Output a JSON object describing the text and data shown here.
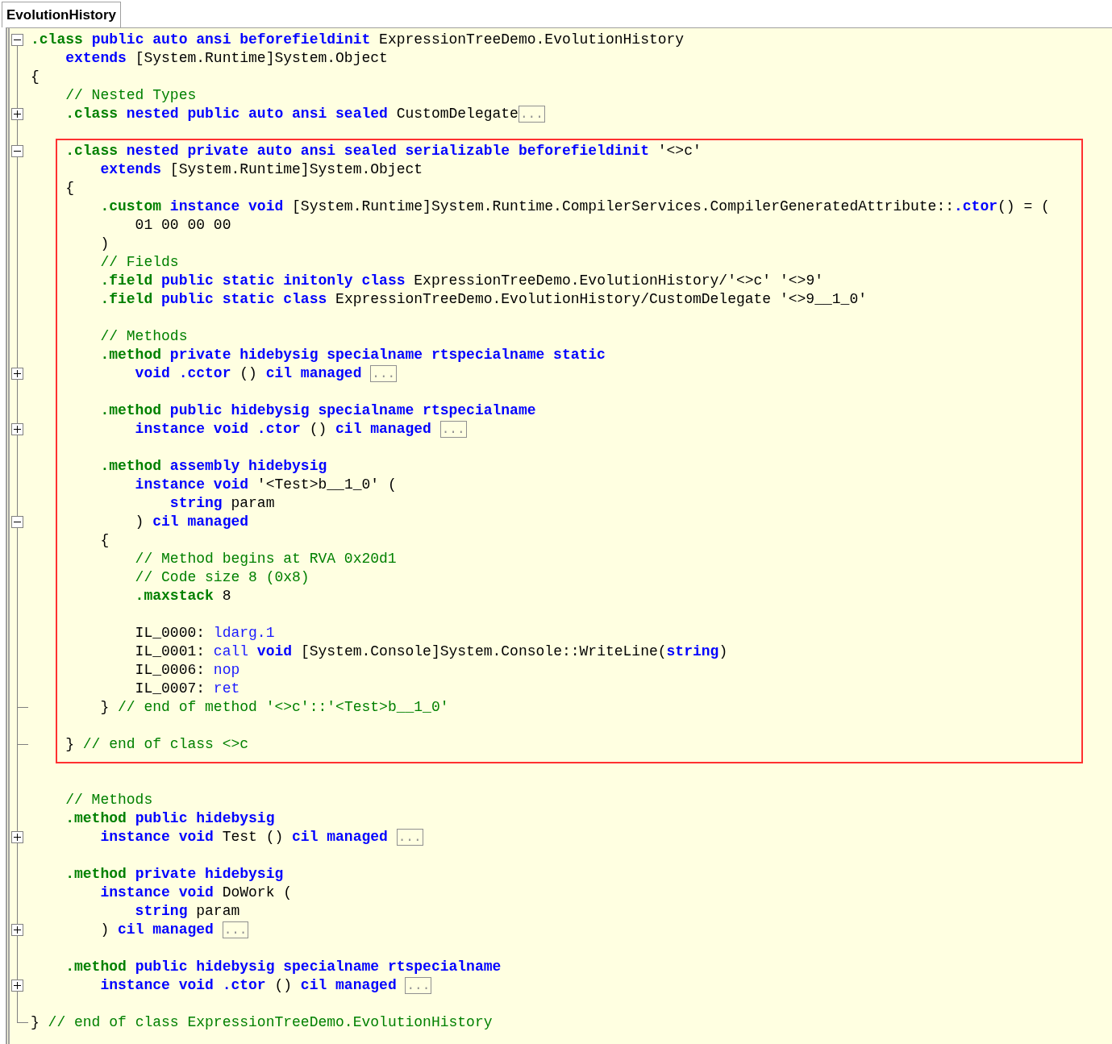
{
  "tab": {
    "label": "EvolutionHistory"
  },
  "blocks": [
    {
      "highlighted": false,
      "lines": [
        {
          "kind": "fold",
          "expanded": true,
          "tokens": [
            {
              "kind": "directive",
              "text": ".class "
            },
            {
              "kind": "keyword",
              "text": "public auto ansi beforefieldinit "
            },
            {
              "kind": "text",
              "text": "ExpressionTreeDemo.EvolutionHistory"
            }
          ]
        },
        {
          "kind": "code",
          "tokens": [
            {
              "kind": "keyword",
              "text": "    extends "
            },
            {
              "kind": "text",
              "text": "[System.Runtime]System.Object"
            }
          ]
        },
        {
          "kind": "code",
          "tokens": [
            {
              "kind": "text",
              "text": "{"
            }
          ]
        },
        {
          "kind": "code",
          "tokens": [
            {
              "kind": "comment",
              "text": "    // Nested Types"
            }
          ]
        },
        {
          "kind": "fold",
          "expanded": false,
          "tokens": [
            {
              "kind": "directive",
              "text": "    .class "
            },
            {
              "kind": "keyword",
              "text": "nested public auto ansi sealed "
            },
            {
              "kind": "text",
              "text": "CustomDelegate"
            }
          ],
          "collapsed": "..."
        },
        {
          "kind": "blank"
        }
      ]
    },
    {
      "highlighted": true,
      "lines": [
        {
          "kind": "fold",
          "expanded": true,
          "tokens": [
            {
              "kind": "directive",
              "text": "    .class "
            },
            {
              "kind": "keyword",
              "text": "nested private auto ansi sealed serializable beforefieldinit "
            },
            {
              "kind": "text",
              "text": "'<>c'"
            }
          ]
        },
        {
          "kind": "code",
          "tokens": [
            {
              "kind": "keyword",
              "text": "        extends "
            },
            {
              "kind": "text",
              "text": "[System.Runtime]System.Object"
            }
          ]
        },
        {
          "kind": "code",
          "tokens": [
            {
              "kind": "text",
              "text": "    {"
            }
          ]
        },
        {
          "kind": "code",
          "tokens": [
            {
              "kind": "directive",
              "text": "        .custom "
            },
            {
              "kind": "keyword",
              "text": "instance void "
            },
            {
              "kind": "text",
              "text": "[System.Runtime]System.Runtime.CompilerServices.CompilerGeneratedAttribute::"
            },
            {
              "kind": "keyword",
              "text": ".ctor"
            },
            {
              "kind": "text",
              "text": "() = ("
            }
          ]
        },
        {
          "kind": "code",
          "tokens": [
            {
              "kind": "text",
              "text": "            01 00 00 00"
            }
          ]
        },
        {
          "kind": "code",
          "tokens": [
            {
              "kind": "text",
              "text": "        )"
            }
          ]
        },
        {
          "kind": "code",
          "tokens": [
            {
              "kind": "comment",
              "text": "        // Fields"
            }
          ]
        },
        {
          "kind": "code",
          "tokens": [
            {
              "kind": "directive",
              "text": "        .field "
            },
            {
              "kind": "keyword",
              "text": "public static initonly class "
            },
            {
              "kind": "text",
              "text": "ExpressionTreeDemo.EvolutionHistory/'<>c' '<>9'"
            }
          ]
        },
        {
          "kind": "code",
          "tokens": [
            {
              "kind": "directive",
              "text": "        .field "
            },
            {
              "kind": "keyword",
              "text": "public static class "
            },
            {
              "kind": "text",
              "text": "ExpressionTreeDemo.EvolutionHistory/CustomDelegate '<>9__1_0'"
            }
          ]
        },
        {
          "kind": "blank"
        },
        {
          "kind": "code",
          "tokens": [
            {
              "kind": "comment",
              "text": "        // Methods"
            }
          ]
        },
        {
          "kind": "code",
          "tokens": [
            {
              "kind": "directive",
              "text": "        .method "
            },
            {
              "kind": "keyword",
              "text": "private hidebysig specialname rtspecialname static"
            }
          ]
        },
        {
          "kind": "fold",
          "expanded": false,
          "tokens": [
            {
              "kind": "keyword",
              "text": "            void .cctor "
            },
            {
              "kind": "text",
              "text": "() "
            },
            {
              "kind": "keyword",
              "text": "cil managed "
            }
          ],
          "collapsed": "..."
        },
        {
          "kind": "blank"
        },
        {
          "kind": "code",
          "tokens": [
            {
              "kind": "directive",
              "text": "        .method "
            },
            {
              "kind": "keyword",
              "text": "public hidebysig specialname rtspecialname"
            }
          ]
        },
        {
          "kind": "fold",
          "expanded": false,
          "tokens": [
            {
              "kind": "keyword",
              "text": "            instance void .ctor "
            },
            {
              "kind": "text",
              "text": "() "
            },
            {
              "kind": "keyword",
              "text": "cil managed "
            }
          ],
          "collapsed": "..."
        },
        {
          "kind": "blank"
        },
        {
          "kind": "code",
          "tokens": [
            {
              "kind": "directive",
              "text": "        .method "
            },
            {
              "kind": "keyword",
              "text": "assembly hidebysig"
            }
          ]
        },
        {
          "kind": "code",
          "tokens": [
            {
              "kind": "keyword",
              "text": "            instance void "
            },
            {
              "kind": "text",
              "text": "'<Test>b__1_0' ("
            }
          ]
        },
        {
          "kind": "code",
          "tokens": [
            {
              "kind": "keyword",
              "text": "                string "
            },
            {
              "kind": "text",
              "text": "param"
            }
          ]
        },
        {
          "kind": "fold",
          "expanded": true,
          "tokens": [
            {
              "kind": "text",
              "text": "            ) "
            },
            {
              "kind": "keyword",
              "text": "cil managed"
            }
          ]
        },
        {
          "kind": "code",
          "tokens": [
            {
              "kind": "text",
              "text": "        {"
            }
          ]
        },
        {
          "kind": "code",
          "tokens": [
            {
              "kind": "comment",
              "text": "            // Method begins at RVA 0x20d1"
            }
          ]
        },
        {
          "kind": "code",
          "tokens": [
            {
              "kind": "comment",
              "text": "            // Code size 8 (0x8)"
            }
          ]
        },
        {
          "kind": "code",
          "tokens": [
            {
              "kind": "directive",
              "text": "            .maxstack "
            },
            {
              "kind": "text",
              "text": "8"
            }
          ]
        },
        {
          "kind": "blank"
        },
        {
          "kind": "code",
          "tokens": [
            {
              "kind": "text",
              "text": "            IL_0000: "
            },
            {
              "kind": "opcode",
              "text": "ldarg.1"
            }
          ]
        },
        {
          "kind": "code",
          "tokens": [
            {
              "kind": "text",
              "text": "            IL_0001: "
            },
            {
              "kind": "opcode",
              "text": "call "
            },
            {
              "kind": "keyword",
              "text": "void "
            },
            {
              "kind": "text",
              "text": "[System.Console]System.Console::WriteLine("
            },
            {
              "kind": "keyword",
              "text": "string"
            },
            {
              "kind": "text",
              "text": ")"
            }
          ]
        },
        {
          "kind": "code",
          "tokens": [
            {
              "kind": "text",
              "text": "            IL_0006: "
            },
            {
              "kind": "opcode",
              "text": "nop"
            }
          ]
        },
        {
          "kind": "code",
          "tokens": [
            {
              "kind": "text",
              "text": "            IL_0007: "
            },
            {
              "kind": "opcode",
              "text": "ret"
            }
          ]
        },
        {
          "kind": "fold-end",
          "tokens": [
            {
              "kind": "text",
              "text": "        } "
            },
            {
              "kind": "comment",
              "text": "// end of method '<>c'::'<Test>b__1_0'"
            }
          ]
        },
        {
          "kind": "blank"
        },
        {
          "kind": "fold-end",
          "tokens": [
            {
              "kind": "text",
              "text": "    } "
            },
            {
              "kind": "comment",
              "text": "// end of class <>c"
            }
          ]
        }
      ]
    },
    {
      "highlighted": false,
      "lines": [
        {
          "kind": "blank"
        },
        {
          "kind": "blank"
        },
        {
          "kind": "code",
          "tokens": [
            {
              "kind": "comment",
              "text": "    // Methods"
            }
          ]
        },
        {
          "kind": "code",
          "tokens": [
            {
              "kind": "directive",
              "text": "    .method "
            },
            {
              "kind": "keyword",
              "text": "public hidebysig"
            }
          ]
        },
        {
          "kind": "fold",
          "expanded": false,
          "tokens": [
            {
              "kind": "keyword",
              "text": "        instance void "
            },
            {
              "kind": "text",
              "text": "Test () "
            },
            {
              "kind": "keyword",
              "text": "cil managed "
            }
          ],
          "collapsed": "..."
        },
        {
          "kind": "blank"
        },
        {
          "kind": "code",
          "tokens": [
            {
              "kind": "directive",
              "text": "    .method "
            },
            {
              "kind": "keyword",
              "text": "private hidebysig"
            }
          ]
        },
        {
          "kind": "code",
          "tokens": [
            {
              "kind": "keyword",
              "text": "        instance void "
            },
            {
              "kind": "text",
              "text": "DoWork ("
            }
          ]
        },
        {
          "kind": "code",
          "tokens": [
            {
              "kind": "keyword",
              "text": "            string "
            },
            {
              "kind": "text",
              "text": "param"
            }
          ]
        },
        {
          "kind": "fold",
          "expanded": false,
          "tokens": [
            {
              "kind": "text",
              "text": "        ) "
            },
            {
              "kind": "keyword",
              "text": "cil managed "
            }
          ],
          "collapsed": "..."
        },
        {
          "kind": "blank"
        },
        {
          "kind": "code",
          "tokens": [
            {
              "kind": "directive",
              "text": "    .method "
            },
            {
              "kind": "keyword",
              "text": "public hidebysig specialname rtspecialname"
            }
          ]
        },
        {
          "kind": "fold",
          "expanded": false,
          "tokens": [
            {
              "kind": "keyword",
              "text": "        instance void .ctor "
            },
            {
              "kind": "text",
              "text": "() "
            },
            {
              "kind": "keyword",
              "text": "cil managed "
            }
          ],
          "collapsed": "..."
        },
        {
          "kind": "blank"
        },
        {
          "kind": "fold-end",
          "tokens": [
            {
              "kind": "text",
              "text": "} "
            },
            {
              "kind": "comment",
              "text": "// end of class ExpressionTreeDemo.EvolutionHistory"
            }
          ]
        }
      ]
    }
  ]
}
